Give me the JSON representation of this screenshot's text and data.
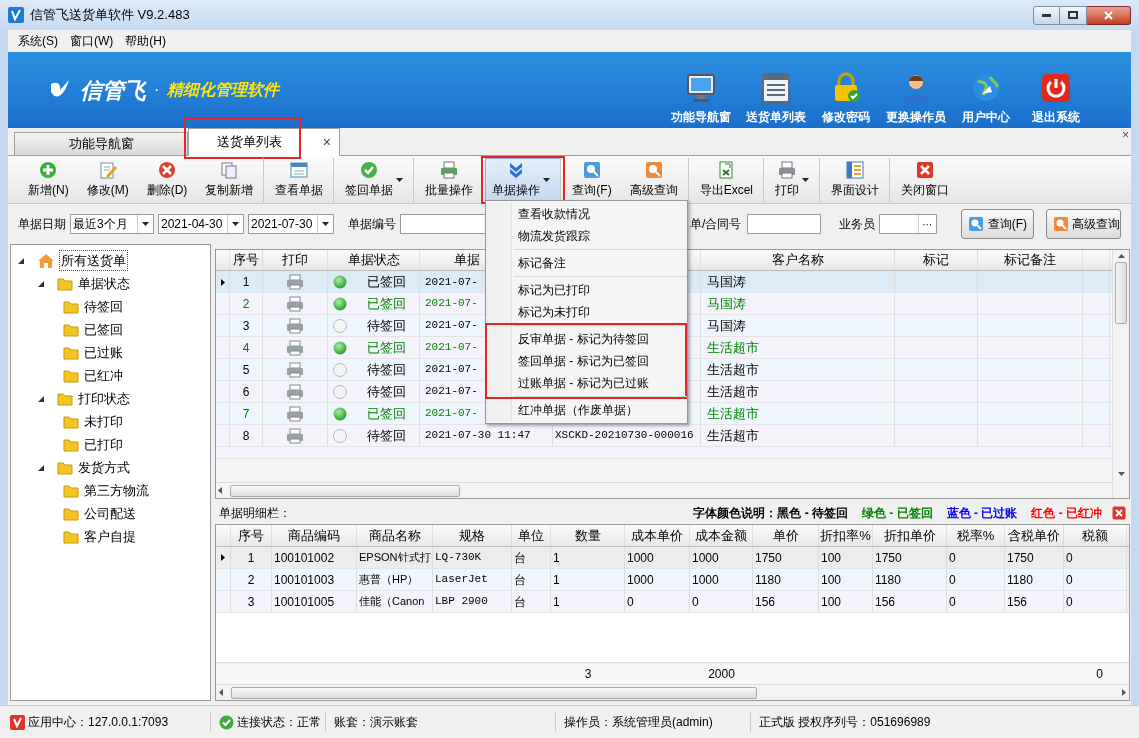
{
  "window": {
    "title": "信管飞送货单软件 V9.2.483"
  },
  "menu_bar": [
    "系统(S)",
    "窗口(W)",
    "帮助(H)"
  ],
  "banner": {
    "logo": "信管飞",
    "separator": "·",
    "slogan": "精细化管理软件",
    "buttons": [
      "功能导航窗",
      "送货单列表",
      "修改密码",
      "更换操作员",
      "用户中心",
      "退出系统"
    ]
  },
  "tabs": [
    {
      "label": "功能导航窗",
      "selected": false,
      "highlighted": false
    },
    {
      "label": "送货单列表",
      "selected": true,
      "highlighted": true,
      "close": "×"
    }
  ],
  "tab_strip_close": "×",
  "toolbar": [
    {
      "label": "新增(N)",
      "dropdown": false,
      "pressed": false,
      "highlighted": false,
      "separator_after": false
    },
    {
      "label": "修改(M)",
      "dropdown": false,
      "pressed": false,
      "highlighted": false,
      "separator_after": false
    },
    {
      "label": "删除(D)",
      "dropdown": false,
      "pressed": false,
      "highlighted": false,
      "separator_after": false
    },
    {
      "label": "复制新增",
      "dropdown": false,
      "pressed": false,
      "highlighted": false,
      "separator_after": true
    },
    {
      "label": "查看单据",
      "dropdown": false,
      "pressed": false,
      "highlighted": false,
      "separator_after": true
    },
    {
      "label": "签回单据",
      "dropdown": true,
      "pressed": false,
      "highlighted": false,
      "separator_after": true
    },
    {
      "label": "批量操作",
      "dropdown": false,
      "pressed": false,
      "highlighted": false,
      "separator_after": false
    },
    {
      "label": "单据操作",
      "dropdown": true,
      "pressed": true,
      "highlighted": true,
      "separator_after": true
    },
    {
      "label": "查询(F)",
      "dropdown": false,
      "pressed": false,
      "highlighted": false,
      "separator_after": false
    },
    {
      "label": "高级查询",
      "dropdown": false,
      "pressed": false,
      "highlighted": false,
      "separator_after": true
    },
    {
      "label": "导出Excel",
      "dropdown": false,
      "pressed": false,
      "highlighted": false,
      "separator_after": true
    },
    {
      "label": "打印",
      "dropdown": true,
      "pressed": false,
      "highlighted": false,
      "separator_after": true
    },
    {
      "label": "界面设计",
      "dropdown": false,
      "pressed": false,
      "highlighted": false,
      "separator_after": true
    },
    {
      "label": "关闭窗口",
      "dropdown": false,
      "pressed": false,
      "highlighted": false,
      "separator_after": false
    }
  ],
  "filter": {
    "date_label": "单据日期",
    "range": "最近3个月",
    "from": "2021-04-30",
    "to": "2021-07-30",
    "number_label": "单据编号",
    "contract_label": "单/合同号",
    "salesperson_label": "业务员",
    "salesperson_button": "···",
    "search_button": "查询(F)",
    "advanced_button": "高级查询"
  },
  "tree": [
    {
      "label": "所有送货单",
      "selected": true,
      "expanded": true,
      "children": [
        {
          "label": "单据状态",
          "selected": false,
          "expanded": true,
          "children": [
            {
              "label": "待签回",
              "selected": false
            },
            {
              "label": "已签回",
              "selected": false
            },
            {
              "label": "已过账",
              "selected": false
            },
            {
              "label": "已红冲",
              "selected": false
            }
          ]
        },
        {
          "label": "打印状态",
          "selected": false,
          "expanded": true,
          "children": [
            {
              "label": "未打印",
              "selected": false
            },
            {
              "label": "已打印",
              "selected": false
            }
          ]
        },
        {
          "label": "发货方式",
          "selected": false,
          "expanded": true,
          "children": [
            {
              "label": "第三方物流",
              "selected": false
            },
            {
              "label": "公司配送",
              "selected": false
            },
            {
              "label": "客户自提",
              "selected": false
            }
          ]
        }
      ]
    }
  ],
  "table": {
    "columns": [
      {
        "label": "序号"
      },
      {
        "label": "打印"
      },
      {
        "label": "单据状态"
      },
      {
        "label": "单据"
      },
      {},
      {
        "label": "客户名称"
      },
      {
        "label": "标记"
      },
      {
        "label": "标记备注"
      },
      {}
    ],
    "rows": [
      {
        "no": "1",
        "status": "已签回",
        "signed": true,
        "selected": true,
        "date": "2021-07-",
        "customer": "马国涛"
      },
      {
        "no": "2",
        "status": "已签回",
        "signed": true,
        "selected": false,
        "date": "2021-07-",
        "customer": "马国涛"
      },
      {
        "no": "3",
        "status": "待签回",
        "signed": false,
        "selected": false,
        "date": "2021-07-",
        "customer": "马国涛"
      },
      {
        "no": "4",
        "status": "已签回",
        "signed": true,
        "selected": false,
        "date": "2021-07-",
        "customer": "生活超市"
      },
      {
        "no": "5",
        "status": "待签回",
        "signed": false,
        "selected": false,
        "date": "2021-07-",
        "customer": "生活超市"
      },
      {
        "no": "6",
        "status": "待签回",
        "signed": false,
        "selected": false,
        "date": "2021-07-",
        "customer": "生活超市"
      },
      {
        "no": "7",
        "status": "已签回",
        "signed": true,
        "selected": false,
        "date": "2021-07-",
        "customer": "生活超市"
      },
      {
        "no": "8",
        "status": "待签回",
        "signed": false,
        "selected": false,
        "date": "2021-07-30 11:47",
        "number": "XSCKD-20210730-000016",
        "customer": "生活超市"
      }
    ]
  },
  "context_menu": [
    {
      "highlighted": false,
      "items": [
        "查看收款情况",
        "物流发货跟踪"
      ]
    },
    {
      "highlighted": false,
      "items": [
        "标记备注"
      ]
    },
    {
      "highlighted": false,
      "items": [
        "标记为已打印",
        "标记为未打印"
      ]
    },
    {
      "highlighted": true,
      "items": [
        "反审单据 - 标记为待签回",
        "签回单据 - 标记为已签回",
        "过账单据 - 标记为已过账"
      ]
    },
    {
      "highlighted": false,
      "items": [
        "红冲单据（作废单据）"
      ]
    }
  ],
  "detail": {
    "title": "单据明细栏：",
    "legend": [
      {
        "text": "字体颜色说明：黑色 - 待签回",
        "color": "#000000"
      },
      {
        "text": "绿色 - 已签回",
        "color": "#008000"
      },
      {
        "text": "蓝色 - 已过账",
        "color": "#0000ff"
      },
      {
        "text": "红色 - 已红冲",
        "color": "#ff0000"
      }
    ],
    "columns": [
      "序号",
      "商品编码",
      "商品名称",
      "规格",
      "单位",
      "数量",
      "成本单价",
      "成本金额",
      "单价",
      "折扣率%",
      "折扣单价",
      "税率%",
      "含税单价",
      "税额"
    ],
    "rows": [
      {
        "selected": true,
        "cells": [
          "1",
          "100101002",
          "EPSON针式打",
          "LQ-730K",
          "台",
          "1",
          "1000",
          "1000",
          "1750",
          "100",
          "1750",
          "0",
          "1750",
          "0"
        ]
      },
      {
        "selected": false,
        "cells": [
          "2",
          "100101003",
          "惠普（HP）",
          "LaserJet",
          "台",
          "1",
          "1000",
          "1000",
          "1180",
          "100",
          "1180",
          "0",
          "1180",
          "0"
        ]
      },
      {
        "selected": false,
        "cells": [
          "3",
          "100101005",
          "佳能（Canon",
          "LBP 2900",
          "台",
          "1",
          "0",
          "0",
          "156",
          "100",
          "156",
          "0",
          "156",
          "0"
        ]
      }
    ],
    "totals": {
      "quantity": "3",
      "cost_amount": "2000",
      "tax": "0"
    }
  },
  "status_bar": [
    {
      "text": "应用中心：127.0.0.1:7093"
    },
    {
      "text": "连接状态：正常"
    },
    {
      "text": "账套：演示账套"
    },
    {
      "text": "操作员：系统管理员(admin)"
    },
    {
      "text": "正式版 授权序列号：051696989"
    }
  ]
}
